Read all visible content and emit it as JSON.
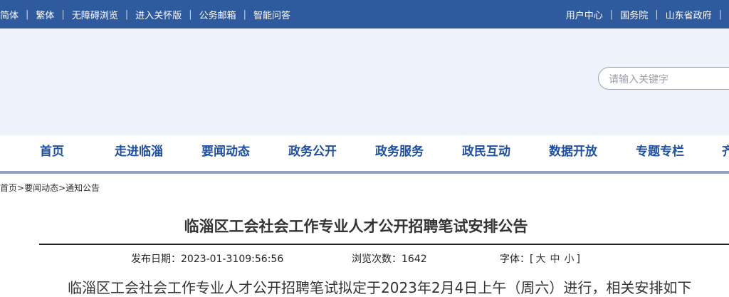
{
  "topbar": {
    "left_links": [
      "简体",
      "繁体",
      "无障碍浏览",
      "进入关怀版",
      "公务邮箱",
      "智能问答"
    ],
    "right_links": [
      "用户中心",
      "国务院",
      "山东省政府"
    ],
    "separator": "|",
    "bg_color": "#2f5a9e"
  },
  "search": {
    "placeholder": "请输入关键字"
  },
  "nav": {
    "items": [
      "首页",
      "走进临淄",
      "要闻动态",
      "政务公开",
      "政务服务",
      "政民互动",
      "数据开放",
      "专题专栏",
      "齐"
    ],
    "text_color": "#1f4fa1"
  },
  "breadcrumb": {
    "items": [
      "首页",
      "要闻动态",
      "通知公告"
    ],
    "separator": ">"
  },
  "article": {
    "title": "临淄区工会社会工作专业人才公开招聘笔试安排公告",
    "publish_label": "发布日期：",
    "publish_date": "2023-01-3109:56:56",
    "views_label": "浏览次数：",
    "views": "1642",
    "font_label": "字体：",
    "font_open": "[",
    "font_sizes": [
      "大",
      "中",
      "小"
    ],
    "font_close": "]",
    "first_line": "临淄区工会社会工作专业人才公开招聘笔试拟定于2023年2月4日上午（周六）进行，相关安排如下"
  }
}
